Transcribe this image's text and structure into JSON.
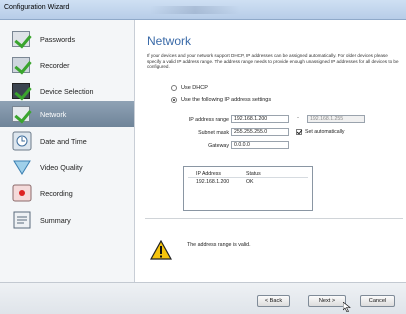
{
  "window": {
    "title": "Configuration Wizard"
  },
  "sidebar": {
    "items": [
      {
        "label": "Passwords",
        "icon": "document-check-icon",
        "active": false
      },
      {
        "label": "Recorder",
        "icon": "recorder-check-icon",
        "active": false
      },
      {
        "label": "Device Selection",
        "icon": "camera-check-icon",
        "active": false
      },
      {
        "label": "Network",
        "icon": "network-check-icon",
        "active": true
      },
      {
        "label": "Date and Time",
        "icon": "clock-icon",
        "active": false
      },
      {
        "label": "Video Quality",
        "icon": "video-quality-icon",
        "active": false
      },
      {
        "label": "Recording",
        "icon": "recording-icon",
        "active": false
      },
      {
        "label": "Summary",
        "icon": "summary-icon",
        "active": false
      }
    ]
  },
  "main": {
    "title": "Network",
    "description": "If your devices and your network support DHCP, IP addresses can be assigned automatically. For older devices please specify a valid IP address range. The address range needs to provide enough unassigned IP addresses for all devices to be configured.",
    "options": {
      "use_dhcp": "Use DHCP",
      "use_following": "Use the following IP address settings"
    },
    "fields": {
      "ip_range_label": "IP address range",
      "ip_range_start": "192.168.1.200",
      "ip_range_end": "192.168.1.255",
      "subnet_label": "Subnet mask",
      "subnet_value": "255.255.255.0",
      "set_auto_label": "Set automatically",
      "gateway_label": "Gateway",
      "gateway_value": "0.0.0.0"
    },
    "table": {
      "headers": [
        "IP Address",
        "Status"
      ],
      "rows": [
        [
          "192.168.1.200",
          "OK"
        ]
      ]
    },
    "message": "The address range is valid."
  },
  "buttons": {
    "back": "< Back",
    "next": "Next >",
    "cancel": "Cancel"
  }
}
